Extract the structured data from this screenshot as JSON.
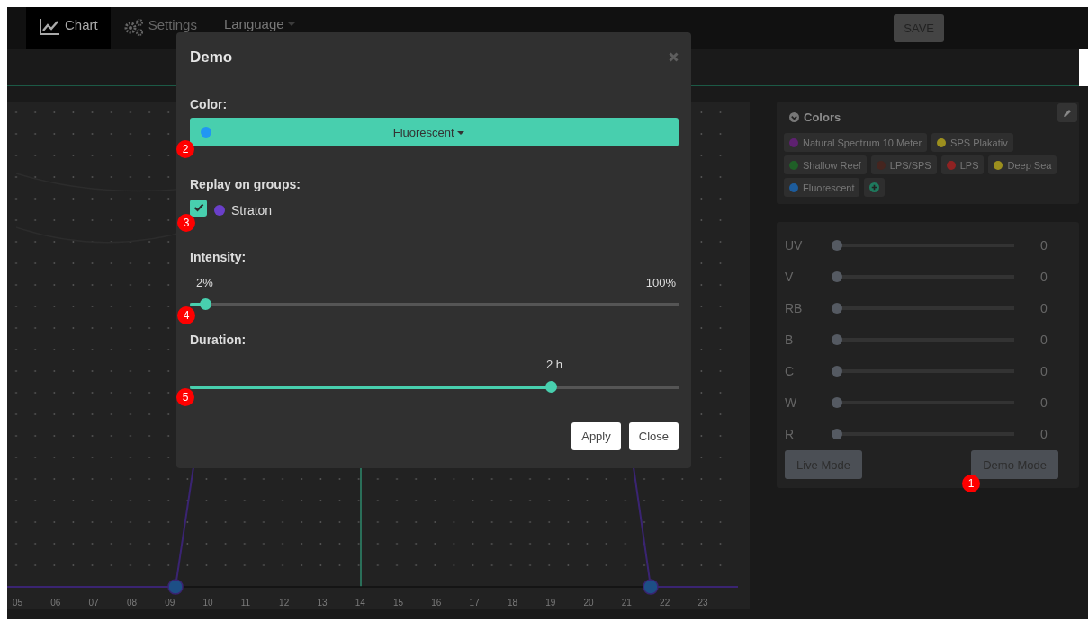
{
  "nav": {
    "tabs": [
      {
        "label": "Chart",
        "selected": true
      },
      {
        "label": "Settings",
        "selected": false
      }
    ],
    "language_menu": "Language",
    "save_button": "SAVE"
  },
  "chart": {
    "hour_labels": [
      "05",
      "06",
      "07",
      "08",
      "09",
      "10",
      "11",
      "12",
      "13",
      "14",
      "15",
      "16",
      "17",
      "18",
      "19",
      "20",
      "21",
      "22",
      "23"
    ]
  },
  "colors_panel": {
    "title": "Colors",
    "tags": [
      {
        "label": "Natural Spectrum 10 Meter",
        "color": "#5e2170"
      },
      {
        "label": "SPS Plakativ",
        "color": "#9c8f1e"
      },
      {
        "label": "Shallow Reef",
        "color": "#1f5f27"
      },
      {
        "label": "LPS/SPS",
        "color": "#45251f"
      },
      {
        "label": "LPS",
        "color": "#8f2222"
      },
      {
        "label": "Deep Sea",
        "color": "#9c8f1e"
      },
      {
        "label": "Fluorescent",
        "color": "#1d5c9c"
      }
    ]
  },
  "channels": [
    {
      "name": "UV",
      "level": 0,
      "reading": "0"
    },
    {
      "name": "V",
      "level": 0,
      "reading": "0"
    },
    {
      "name": "RB",
      "level": 0,
      "reading": "0"
    },
    {
      "name": "B",
      "level": 0,
      "reading": "0"
    },
    {
      "name": "C",
      "level": 0,
      "reading": "0"
    },
    {
      "name": "W",
      "level": 0,
      "reading": "0"
    },
    {
      "name": "R",
      "level": 0,
      "reading": "0"
    }
  ],
  "mode_buttons": [
    "Live Mode",
    "Demo Mode"
  ],
  "dialog": {
    "title": "Demo",
    "color_label": "Color:",
    "color_select": {
      "value": "Fluorescent",
      "color": "#2196f3"
    },
    "groups_label": "Replay on groups:",
    "groups": [
      {
        "name": "Straton",
        "color": "#6a3fc9",
        "checked": true
      }
    ],
    "intensity_label": "Intensity:",
    "intensity": {
      "reading": "2%",
      "max_label": "100%",
      "level": 0.02
    },
    "duration_label": "Duration:",
    "duration": {
      "reading": "2 h",
      "level": 0.746
    },
    "buttons": [
      "Apply",
      "Close"
    ]
  },
  "annotations": [
    "1",
    "2",
    "3",
    "4",
    "5"
  ]
}
